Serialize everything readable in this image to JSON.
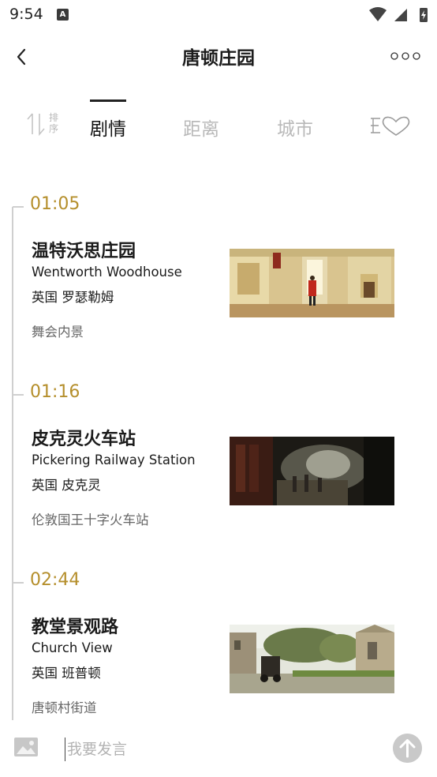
{
  "status_bar": {
    "time": "9:54",
    "notification_glyph": "A"
  },
  "header": {
    "title": "唐顿庄园"
  },
  "sort": {
    "label": "排序"
  },
  "tabs": [
    {
      "label": "剧情",
      "active": true
    },
    {
      "label": "距离",
      "active": false
    },
    {
      "label": "城市",
      "active": false
    }
  ],
  "colors": {
    "accent": "#b58f2c",
    "timeline": "#cfcfcf",
    "inactive_tab": "#b9b9b9"
  },
  "entries": [
    {
      "time": "01:05",
      "title": "温特沃思庄园",
      "english": "Wentworth Woodhouse",
      "location": "英国 罗瑟勒姆",
      "description": "舞会内景",
      "image": "wentworth-interior-image"
    },
    {
      "time": "01:16",
      "title": "皮克灵火车站",
      "english": "Pickering Railway Station",
      "location": "英国 皮克灵",
      "description": "伦敦国王十字火车站",
      "image": "railway-station-image"
    },
    {
      "time": "02:44",
      "title": "教堂景观路",
      "english": "Church View",
      "location": "英国 班普顿",
      "description": "唐顿村街道",
      "image": "church-view-image"
    }
  ],
  "input": {
    "placeholder": "我要发言"
  },
  "icons": [
    "back-icon",
    "more-icon",
    "sort-icon",
    "filter-favorite-icon",
    "image-icon",
    "send-icon"
  ]
}
